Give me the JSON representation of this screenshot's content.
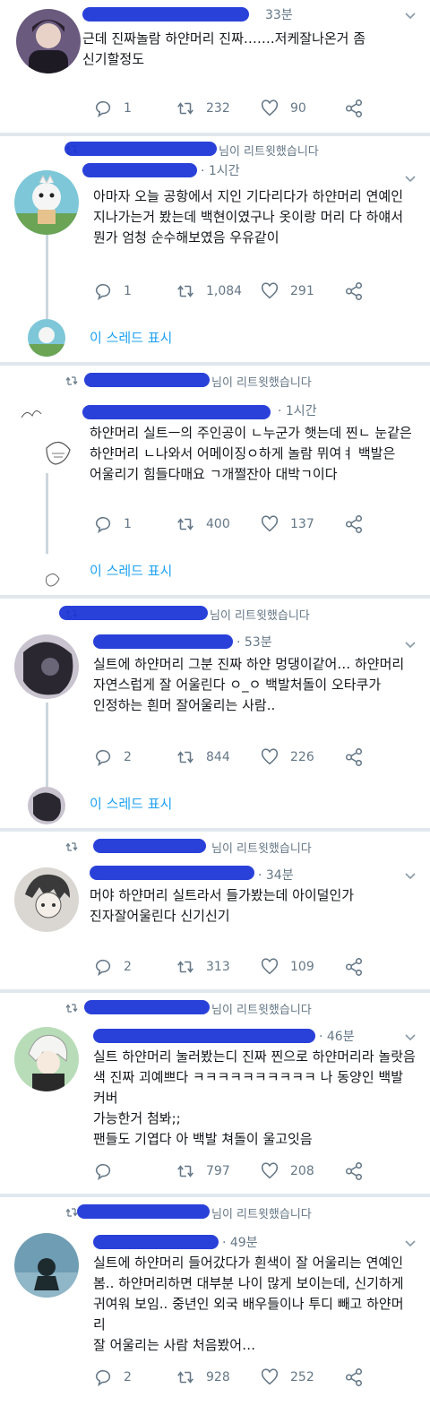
{
  "tweets": [
    {
      "time": "33분",
      "text": "근데 진짜놀람 하얀머리 진짜…….저케잘나온거 좀\n신기할정도",
      "replies": "1",
      "retweets": "232",
      "likes": "90"
    },
    {
      "retweet_label": "님이 리트윗했습니다",
      "time": "· 1시간",
      "text": "아마자 오늘 공항에서 지인 기다리다가 하얀머리 연예인\n지나가는거 봤는데 백현이였구나 옷이랑 머리 다 하얘서\n뭔가 엄청 순수해보였음 우유같이",
      "replies": "1",
      "retweets": "1,084",
      "likes": "291",
      "show_thread": "이 스레드 표시"
    },
    {
      "retweet_label": "님이 리트윗했습니다",
      "time": "· 1시간",
      "text": "하얀머리 실트ㅡ의 주인공이 ㄴ누군가 햇는데 찐ㄴ 눈같은\n하얀머리 ㄴ나와서 어메이징ㅇ하게 놀람 뮈여ㅕ 백발은\n어울리기 힘들다매요 ㄱ개쩔잔아 대박ㄱ이다",
      "replies": "1",
      "retweets": "400",
      "likes": "137",
      "show_thread": "이 스레드 표시"
    },
    {
      "retweet_label": "님이 리트윗했습니다",
      "time": "· 53분",
      "text": "실트에 하얀머리 그분 진짜 하얀 멍댕이같어… 하얀머리\n자연스럽게 잘 어울린다 ㅇ_ㅇ 백발처돌이 오타쿠가\n인정하는 흰머 잘어울리는 사람..",
      "replies": "2",
      "retweets": "844",
      "likes": "226",
      "show_thread": "이 스레드 표시"
    },
    {
      "retweet_label": "님이 리트윗했습니다",
      "time": "· 34분",
      "text": "머야 하얀머리 실트라서 들가봤는데 아이덜인가\n진자잘어울린다  신기신기",
      "replies": "2",
      "retweets": "313",
      "likes": "109"
    },
    {
      "retweet_label": "님이 리트윗했습니다",
      "time": "· 46분",
      "text": "실트 하얀머리 눌러봤는디 진짜 찐으로 하얀머리라 놀랏음\n색 진짜 괴예쁘다 ㅋㅋㅋㅋㅋㅋㅋㅋㅋㅋ 나 동양인 백발 커버\n가능한거 첨봐;;\n팬들도 기엽다 아 백발 쳐돌이 울고잇음",
      "replies": "",
      "retweets": "797",
      "likes": "208"
    },
    {
      "retweet_label": "님이 리트윗했습니다",
      "time": "· 49분",
      "text": "실트에 하얀머리 들어갔다가 흰색이 잘 어울리는 연예인\n봄.. 하얀머리하면 대부분 나이 많게 보이는데, 신기하게\n귀여워 보임.. 중년인 외국 배우들이나 투디 빼고 하얀머리\n잘 어울리는 사람 처음봤어…",
      "replies": "2",
      "retweets": "928",
      "likes": "252"
    }
  ],
  "colors": {
    "accent": "#1da1f2",
    "muted": "#657786",
    "redaction": "#1a33d6",
    "separator": "#e1e8ed"
  },
  "icons": [
    "reply-icon",
    "retweet-icon",
    "like-icon",
    "share-icon",
    "chevron-down-icon",
    "retweet-small-icon"
  ]
}
